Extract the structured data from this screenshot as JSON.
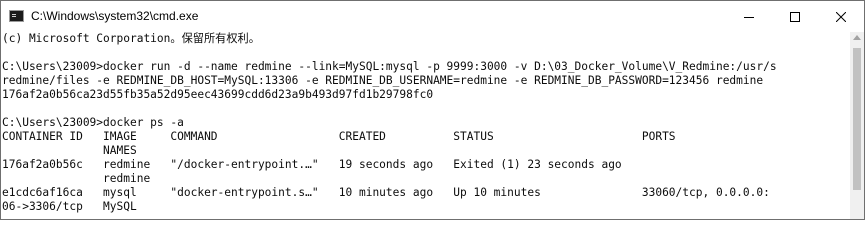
{
  "window": {
    "title": "C:\\Windows\\system32\\cmd.exe",
    "icon": "cmd-icon",
    "controls": [
      "minimize-icon",
      "maximize-icon",
      "close-icon"
    ]
  },
  "console": {
    "lines": [
      "(c) Microsoft Corporation。保留所有权利。",
      "",
      "C:\\Users\\23009>docker run -d --name redmine --link=MySQL:mysql -p 9999:3000 -v D:\\03_Docker_Volume\\V_Redmine:/usr/s",
      "redmine/files -e REDMINE_DB_HOST=MySQL:13306 -e REDMINE_DB_USERNAME=redmine -e REDMINE_DB_PASSWORD=123456 redmine",
      "176af2a0b56ca23d55fb35a52d95eec43699cdd6d23a9b493d97fd1b29798fc0",
      "",
      "C:\\Users\\23009>docker ps -a",
      "CONTAINER ID   IMAGE     COMMAND                  CREATED          STATUS                      PORTS",
      "               NAMES",
      "176af2a0b56c   redmine   \"/docker-entrypoint.…\"   19 seconds ago   Exited (1) 23 seconds ago",
      "               redmine",
      "e1cdc6af16ca   mysql     \"docker-entrypoint.s…\"   10 minutes ago   Up 10 minutes               33060/tcp, 0.0.0.0:",
      "06->3306/tcp   MySQL"
    ]
  }
}
